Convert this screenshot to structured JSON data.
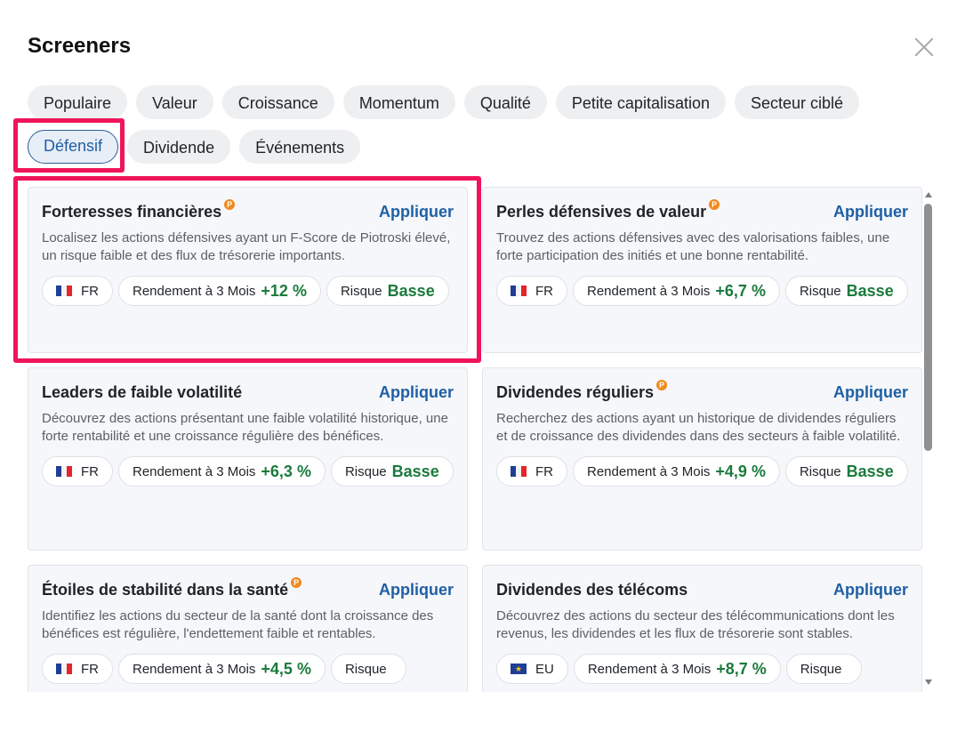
{
  "title": "Screeners",
  "tabs": [
    {
      "label": "Populaire"
    },
    {
      "label": "Valeur"
    },
    {
      "label": "Croissance"
    },
    {
      "label": "Momentum"
    },
    {
      "label": "Qualité"
    },
    {
      "label": "Petite capitalisation"
    },
    {
      "label": "Secteur ciblé"
    },
    {
      "label": "Défensif",
      "active": true
    },
    {
      "label": "Dividende"
    },
    {
      "label": "Événements"
    }
  ],
  "labels": {
    "apply": "Appliquer",
    "return": "Rendement à 3 Mois",
    "risk": "Risque",
    "pro_badge": "P"
  },
  "cards": [
    {
      "title": "Forteresses financières",
      "pro": true,
      "desc": "Localisez les actions défensives ayant un F-Score de Piotroski élevé, un risque faible et des flux de trésorerie importants.",
      "region": "FR",
      "flag": "fr",
      "return_value": "+12 %",
      "risk_value": "Basse"
    },
    {
      "title": "Perles défensives de valeur",
      "pro": true,
      "desc": "Trouvez des actions défensives avec des valorisations faibles, une forte participation des initiés et une bonne rentabilité.",
      "region": "FR",
      "flag": "fr",
      "return_value": "+6,7 %",
      "risk_value": "Basse"
    },
    {
      "title": "Leaders de faible volatilité",
      "pro": false,
      "desc": "Découvrez des actions présentant une faible volatilité historique, une forte rentabilité et une croissance régulière des bénéfices.",
      "region": "FR",
      "flag": "fr",
      "return_value": "+6,3 %",
      "risk_value": "Basse"
    },
    {
      "title": "Dividendes réguliers",
      "pro": true,
      "desc": "Recherchez des actions ayant un historique de dividendes réguliers et de croissance des dividendes dans des secteurs à faible volatilité.",
      "region": "FR",
      "flag": "fr",
      "return_value": "+4,9 %",
      "risk_value": "Basse"
    },
    {
      "title": "Étoiles de stabilité dans la santé",
      "pro": true,
      "desc": "Identifiez les actions du secteur de la santé dont la croissance des bénéfices est régulière, l'endettement faible et rentables.",
      "region": "FR",
      "flag": "fr",
      "return_value": "+4,5 %",
      "risk_value": ""
    },
    {
      "title": "Dividendes des télécoms",
      "pro": false,
      "desc": "Découvrez des actions du secteur des télécommunications dont les revenus, les dividendes et les flux de trésorerie sont stables.",
      "region": "EU",
      "flag": "eu",
      "return_value": "+8,7 %",
      "risk_value": ""
    }
  ],
  "colors": {
    "accent": "#1f5fa5",
    "positive": "#1b7a3c",
    "highlight": "#f0145a",
    "badge": "#f08a1d"
  }
}
